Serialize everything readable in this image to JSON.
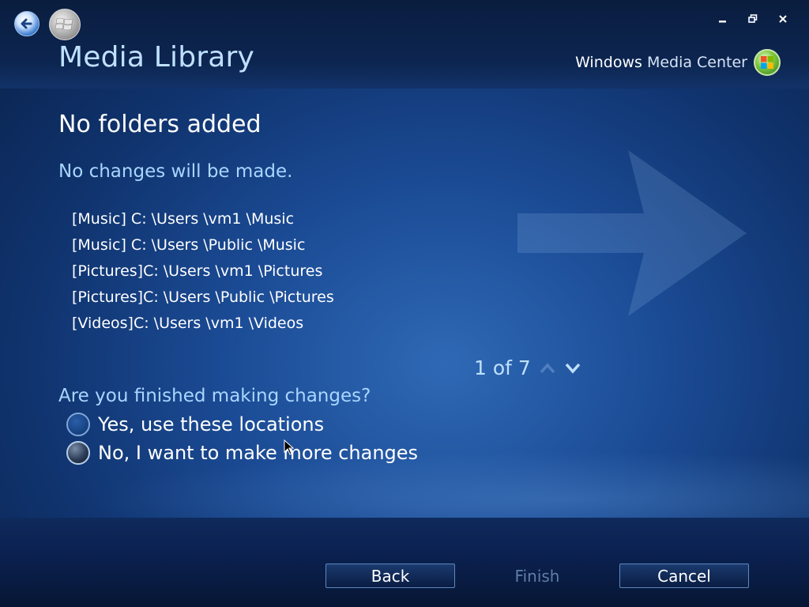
{
  "window": {
    "title": "Media Library",
    "brand_bold": "Windows",
    "brand_light": "Media Center",
    "icons": [
      "back-arrow-icon",
      "windows-start-icon",
      "minimize-icon",
      "restore-icon",
      "close-icon",
      "windows-logo-icon"
    ]
  },
  "main": {
    "heading": "No folders added",
    "subheading": "No changes will be made.",
    "folders": [
      "[Music] C: \\Users \\vm1 \\Music",
      "[Music] C: \\Users \\Public \\Music",
      "[Pictures]C: \\Users \\vm1 \\Pictures",
      "[Pictures]C: \\Users \\Public \\Pictures",
      "[Videos]C: \\Users \\vm1 \\Videos"
    ],
    "pager": "1 of 7"
  },
  "question": {
    "label": "Are you finished making changes?",
    "options": [
      {
        "label": "Yes, use these locations",
        "selected": false
      },
      {
        "label": "No, I want to make more changes",
        "selected": true
      }
    ]
  },
  "footer": {
    "back": "Back",
    "finish": "Finish",
    "cancel": "Cancel"
  },
  "colors": {
    "accent_text": "#a9d6ff",
    "title_text": "#bfe0ff",
    "disabled_text": "#5f7da8",
    "background": "#1b4b95"
  }
}
